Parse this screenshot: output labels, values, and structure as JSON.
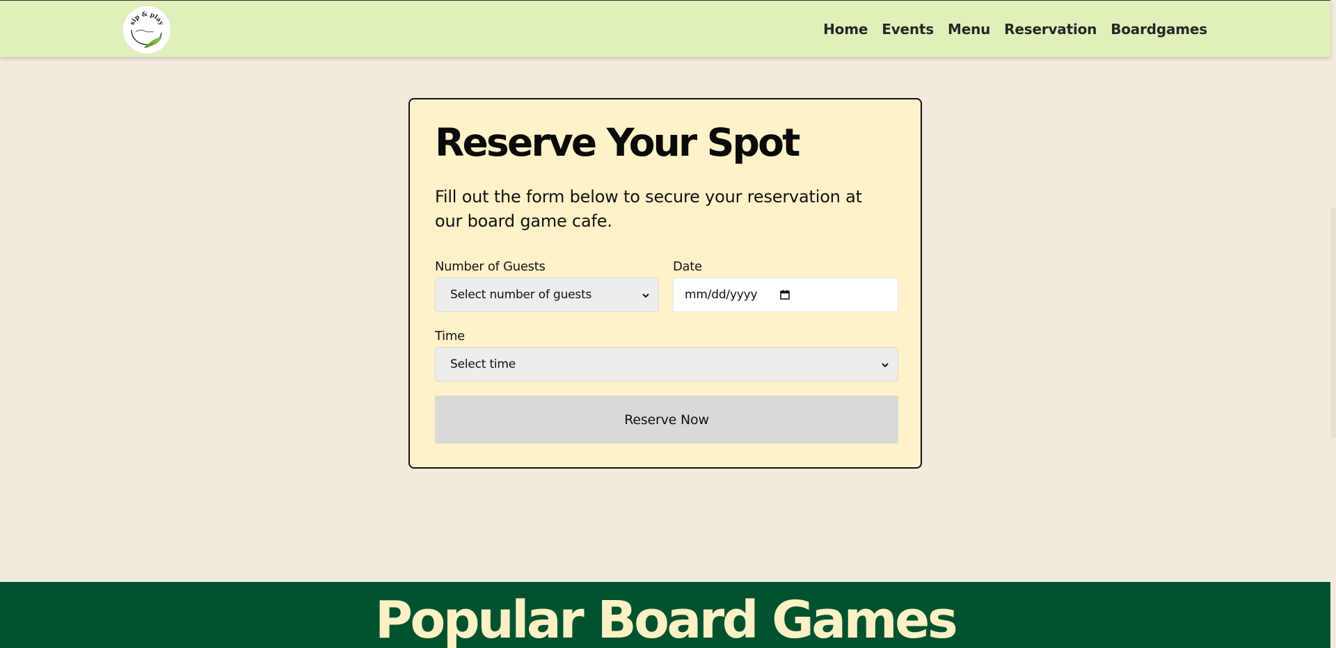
{
  "nav": {
    "logo_text": "sip & play",
    "links": [
      "Home",
      "Events",
      "Menu",
      "Reservation",
      "Boardgames"
    ]
  },
  "reservation": {
    "title": "Reserve Your Spot",
    "subtitle": "Fill out the form below to secure your reservation at our board game cafe.",
    "guests_label": "Number of Guests",
    "guests_value": "Select number of guests",
    "date_label": "Date",
    "date_placeholder": "mm/dd/yyyy",
    "time_label": "Time",
    "time_value": "Select time",
    "submit_label": "Reserve Now"
  },
  "popular": {
    "heading": "Popular Board Games"
  },
  "colors": {
    "nav_bg": "#e0f0bb",
    "page_bg": "#f2eadd",
    "card_bg": "#fff2c9",
    "footer_bg": "#01522f",
    "footer_text": "#fdf0c4",
    "button_bg": "#d9d9d9"
  }
}
